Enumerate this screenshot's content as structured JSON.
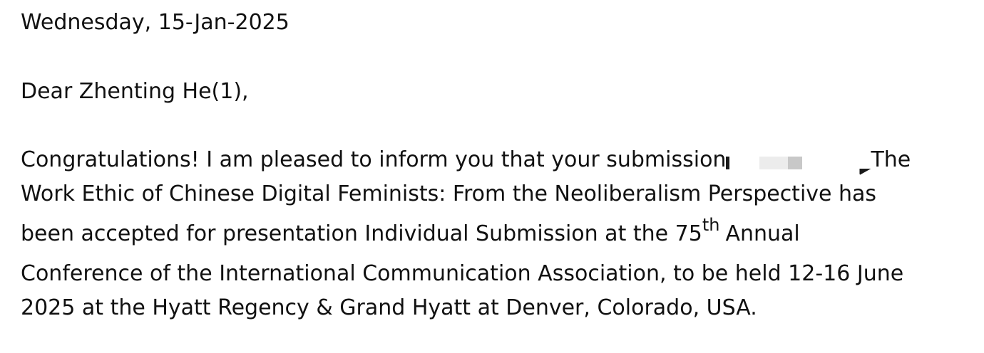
{
  "letter": {
    "date": "Wednesday, 15-Jan-2025",
    "salutation": "Dear Zhenting He(1),",
    "body": {
      "line1_before_redaction": "Congratulations! I am pleased to inform you that your submission",
      "line1_after_redaction": "The",
      "line2": "Work Ethic of Chinese Digital Feminists: From the Neoliberalism Perspective has",
      "line3_before_sup": "been accepted for presentation Individual Submission at the 75",
      "line3_sup": "th",
      "line3_after_sup": "Annual",
      "line4": "Conference of the International Communication Association, to be held 12-16 June",
      "line5": "2025 at the Hyatt Regency & Grand Hyatt at Denver, Colorado, USA."
    }
  }
}
